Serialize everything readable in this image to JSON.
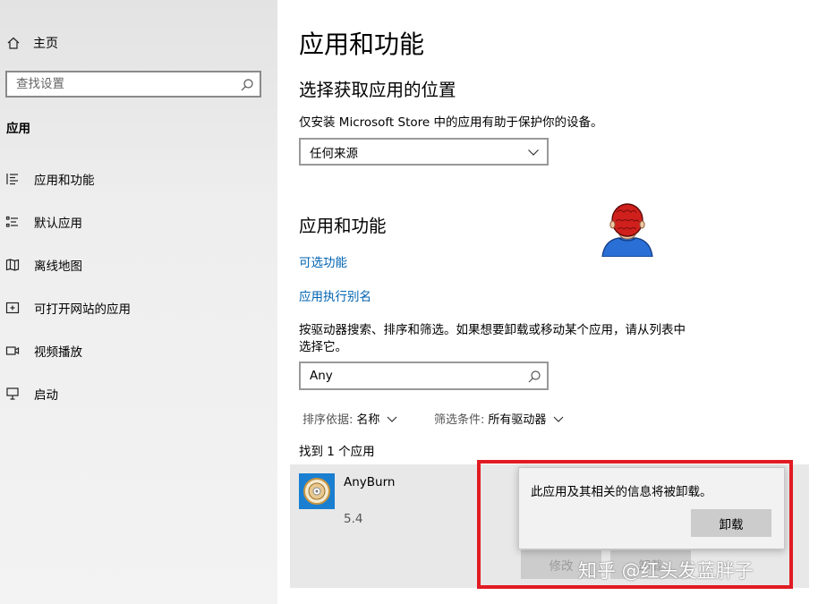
{
  "sidebar": {
    "home_label": "主页",
    "search_placeholder": "查找设置",
    "section_label": "应用",
    "items": [
      {
        "label": "应用和功能",
        "icon": "apps-list-icon"
      },
      {
        "label": "默认应用",
        "icon": "default-apps-icon"
      },
      {
        "label": "离线地图",
        "icon": "map-icon"
      },
      {
        "label": "可打开网站的应用",
        "icon": "website-app-icon"
      },
      {
        "label": "视频播放",
        "icon": "video-icon"
      },
      {
        "label": "启动",
        "icon": "startup-icon"
      }
    ]
  },
  "main": {
    "title": "应用和功能",
    "source_heading": "选择获取应用的位置",
    "source_description": "仅安装 Microsoft Store 中的应用有助于保护你的设备。",
    "source_dropdown_value": "任何来源",
    "apps_heading": "应用和功能",
    "link_optional_features": "可选功能",
    "link_app_aliases": "应用执行别名",
    "search_description_line1": "按驱动器搜索、排序和筛选。如果想要卸载或移动某个应用，请从列表中",
    "search_description_line2": "选择它。",
    "search_value": "Any",
    "sort_label": "排序依据:",
    "sort_value": "名称",
    "filter_label": "筛选条件:",
    "filter_value": "所有驱动器",
    "found_text": "找到 1 个应用",
    "app": {
      "name": "AnyBurn",
      "version": "5.4",
      "modify_label": "修改",
      "uninstall_label": "卸载"
    }
  },
  "popup": {
    "message": "此应用及其相关的信息将被卸载。",
    "confirm_label": "卸载"
  },
  "watermark": "知乎 @红头发蓝胖子",
  "colors": {
    "accent_link": "#0063b1",
    "highlight_box": "#e11b22",
    "sidebar_bg": "#eeeeee",
    "button_bg": "#cccccc"
  }
}
